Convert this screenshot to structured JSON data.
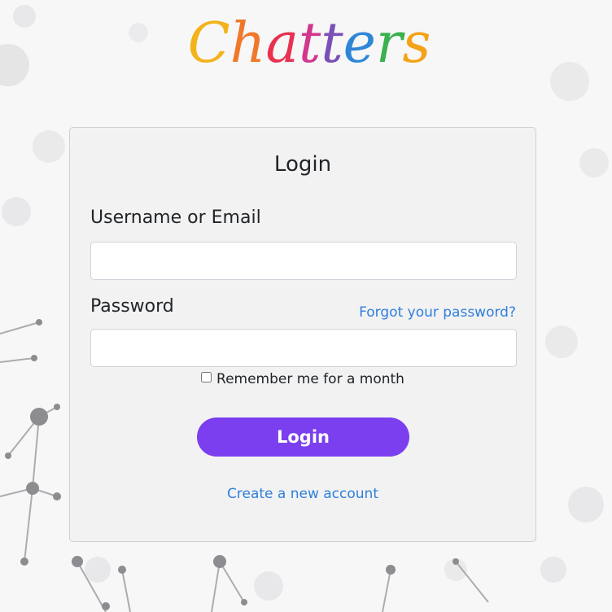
{
  "brand": {
    "name": "Chatters",
    "letter_colors": [
      "#f2b31b",
      "#f0782b",
      "#e9314f",
      "#d1378d",
      "#7a4fb6",
      "#2f86d7",
      "#3ab14e",
      "#f4a218",
      "#ef6a2d"
    ]
  },
  "login": {
    "title": "Login",
    "username_label": "Username or Email",
    "username_value": "",
    "password_label": "Password",
    "password_value": "",
    "forgot_link": "Forgot your password?",
    "remember_label": "Remember me for a month",
    "remember_checked": false,
    "submit_label": "Login",
    "create_account_link": "Create a new account"
  },
  "colors": {
    "accent": "#7b3ff0",
    "link": "#2f7fdc",
    "card_bg": "#f2f2f2"
  }
}
